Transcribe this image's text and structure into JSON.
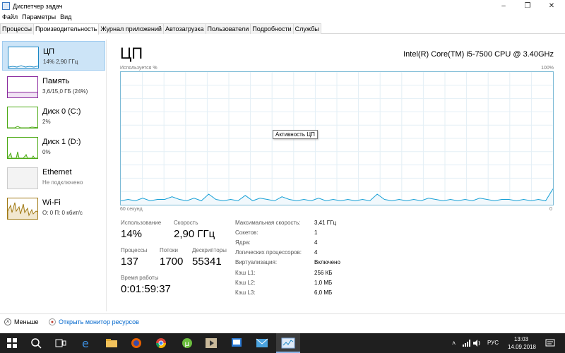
{
  "window": {
    "title": "Диспетчер задач"
  },
  "menu": [
    "Файл",
    "Параметры",
    "Вид"
  ],
  "tabs": [
    "Процессы",
    "Производительность",
    "Журнал приложений",
    "Автозагрузка",
    "Пользователи",
    "Подробности",
    "Службы"
  ],
  "sidebar": {
    "items": [
      {
        "name": "ЦП",
        "sub": "14% 2,90 ГГц"
      },
      {
        "name": "Память",
        "sub": "3,6/15,0 ГБ (24%)"
      },
      {
        "name": "Диск 0 (C:)",
        "sub": "2%"
      },
      {
        "name": "Диск 1 (D:)",
        "sub": "0%"
      },
      {
        "name": "Ethernet",
        "sub": "Не подключено"
      },
      {
        "name": "Wi-Fi",
        "sub": "О: 0 П: 0 кбит/с"
      }
    ]
  },
  "main": {
    "title": "ЦП",
    "cpu_name": "Intel(R) Core(TM) i5-7500 CPU @ 3.40GHz",
    "graph_top_left": "Используется %",
    "graph_top_right": "100%",
    "graph_bottom_left": "60 секунд",
    "graph_bottom_right": "0",
    "tooltip": "Активность ЦП",
    "utilization_series_percent": [
      3,
      4,
      3,
      5,
      3,
      4,
      4,
      6,
      4,
      3,
      5,
      3,
      8,
      4,
      3,
      4,
      3,
      7,
      3,
      5,
      4,
      3,
      6,
      4,
      3,
      4,
      3,
      5,
      3,
      4,
      3,
      4,
      3,
      4,
      3,
      8,
      4,
      3,
      4,
      3,
      4,
      3,
      5,
      4,
      3,
      4,
      3,
      4,
      3,
      5,
      4,
      3,
      4,
      4,
      3,
      4,
      3,
      4,
      3,
      12
    ]
  },
  "stats": {
    "utilization_label": "Использование",
    "utilization_value": "14%",
    "speed_label": "Скорость",
    "speed_value": "2,90 ГГц",
    "processes_label": "Процессы",
    "processes_value": "137",
    "threads_label": "Потоки",
    "threads_value": "1700",
    "handles_label": "Дескрипторы",
    "handles_value": "55341",
    "uptime_label": "Время работы",
    "uptime_value": "0:01:59:37"
  },
  "info": [
    {
      "key": "Максимальная скорость:",
      "value": "3,41 ГГц"
    },
    {
      "key": "Сокетов:",
      "value": "1"
    },
    {
      "key": "Ядра:",
      "value": "4"
    },
    {
      "key": "Логических процессоров:",
      "value": "4"
    },
    {
      "key": "Виртуализация:",
      "value": "Включено"
    },
    {
      "key": "Кэш L1:",
      "value": "256 КБ"
    },
    {
      "key": "Кэш L2:",
      "value": "1,0 МБ"
    },
    {
      "key": "Кэш L3:",
      "value": "6,0 МБ"
    }
  ],
  "footer": {
    "less_label": "Меньше",
    "resource_monitor_label": "Открыть монитор ресурсов"
  },
  "taskbar": {
    "lang": "РУС",
    "time": "13:03",
    "date": "14.09.2018"
  },
  "colors": {
    "accent": "#1b88c5",
    "cpu_line": "#17a0d6",
    "memory": "#8b2a9e",
    "disk": "#4caa14",
    "wifi": "#a07914"
  }
}
